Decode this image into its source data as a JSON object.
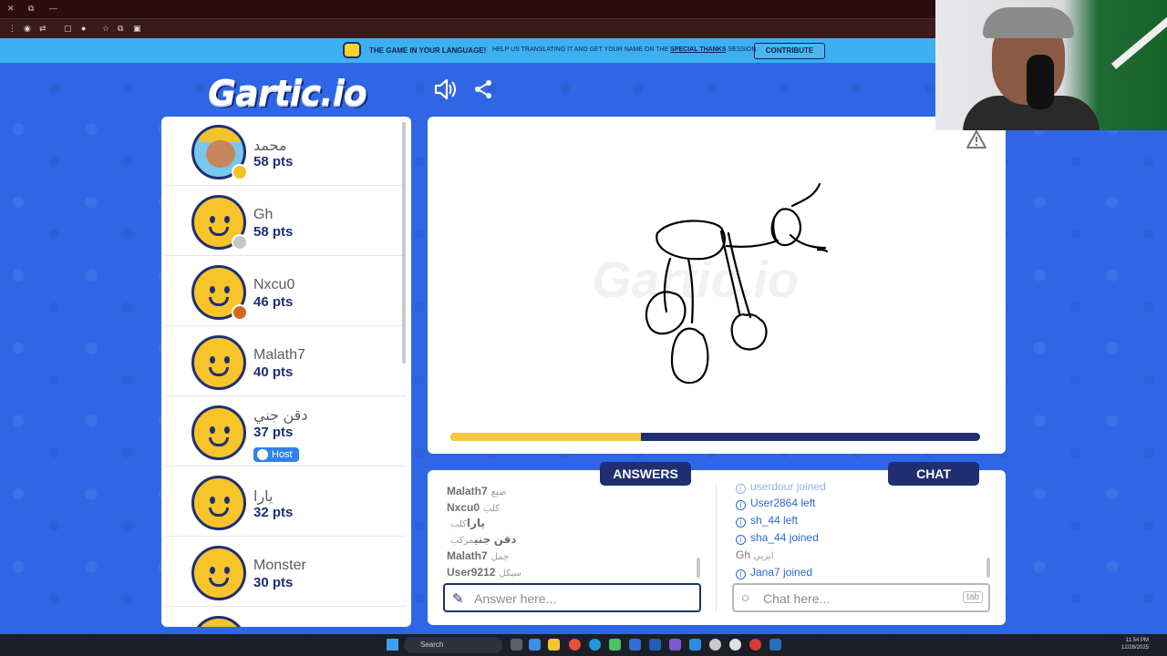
{
  "banner": {
    "main": "THE GAME IN YOUR LANGUAGE!",
    "sub_prefix": "HELP US TRANSLATING IT AND GET YOUR NAME ON THE",
    "sub_link": "SPECIAL THANKS",
    "sub_suffix": "SESSION",
    "button": "CONTRIBUTE"
  },
  "logo": "Gartic.io",
  "canvas_watermark": "Gartic.io",
  "players": [
    {
      "name": "محمد",
      "points": "58 pts",
      "status_color": "#f4c31d",
      "host": ""
    },
    {
      "name": "Gh",
      "points": "58 pts",
      "status_color": "#c8c8c8",
      "host": ""
    },
    {
      "name": "Nxcu0",
      "points": "46 pts",
      "status_color": "#d2691e",
      "host": ""
    },
    {
      "name": "Malath7",
      "points": "40 pts",
      "status_color": "",
      "host": ""
    },
    {
      "name": "دقن جني",
      "points": "37 pts",
      "status_color": "",
      "host": "Host"
    },
    {
      "name": "يارا",
      "points": "32 pts",
      "status_color": "",
      "host": ""
    },
    {
      "name": "Monster",
      "points": "30 pts",
      "status_color": "",
      "host": ""
    }
  ],
  "timer_progress": 0.36,
  "tabs": {
    "answers": "ANSWERS",
    "chat": "CHAT"
  },
  "answers": [
    {
      "user": "Malath7",
      "text": "ضبع"
    },
    {
      "user": "Nxcu0",
      "text": "كلب"
    },
    {
      "user": "يارا",
      "text": "كلب"
    },
    {
      "user": "دقن جني",
      "text": "مركب"
    },
    {
      "user": "Malath7",
      "text": "جمل"
    },
    {
      "user": "User9212",
      "text": "سيكل"
    }
  ],
  "chat": [
    {
      "user": "userdour",
      "text": "joined",
      "info": true
    },
    {
      "user": "User2864",
      "text": "left",
      "info": true
    },
    {
      "user": "sh_44",
      "text": "left",
      "info": true
    },
    {
      "user": "sha_44",
      "text": "joined",
      "info": true
    },
    {
      "user": "Gh",
      "text": "ايزيي",
      "info": false
    },
    {
      "user": "Jana7",
      "text": "joined",
      "info": true
    }
  ],
  "answer_input": {
    "placeholder": "Answer here..."
  },
  "chat_input": {
    "placeholder": "Chat here...",
    "key_hint": "tab"
  },
  "taskbar": {
    "search": "Search",
    "time": "11:54 PM",
    "date": "12/28/2025"
  },
  "colors": {
    "page_bg": "#2f66e6",
    "banner": "#3db0f2",
    "navy": "#1f2f72",
    "gold": "#f4c843"
  }
}
